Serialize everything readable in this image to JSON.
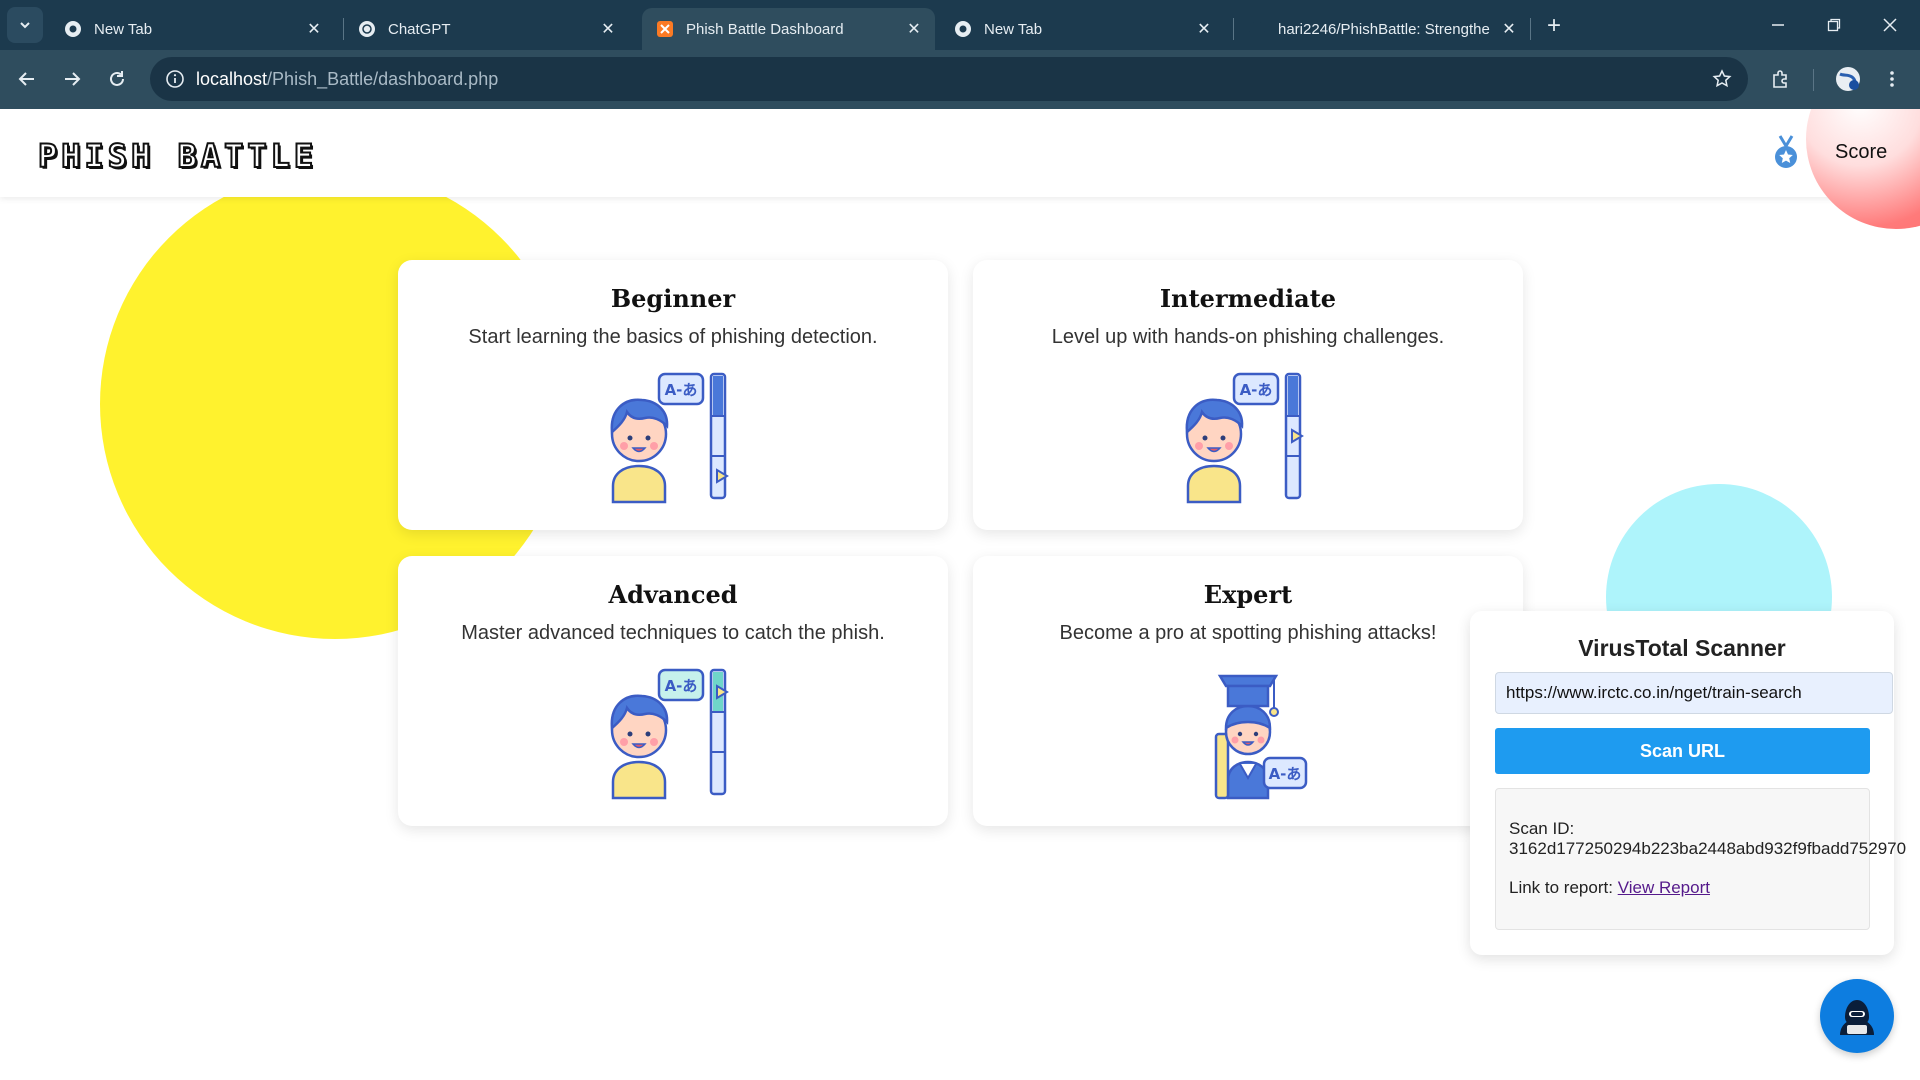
{
  "browser": {
    "tabs": [
      {
        "title": "New Tab",
        "icon": "chrome-icon",
        "active": false
      },
      {
        "title": "ChatGPT",
        "icon": "openai-icon",
        "active": false
      },
      {
        "title": "Phish Battle Dashboard",
        "icon": "xampp-icon",
        "active": true
      },
      {
        "title": "New Tab",
        "icon": "chrome-icon",
        "active": false
      },
      {
        "title": "hari2246/PhishBattle: Strengthe",
        "icon": "github-icon",
        "active": false
      }
    ],
    "url_host": "localhost",
    "url_path": "/Phish_Battle/dashboard.php"
  },
  "header": {
    "logo": "PHISH BATTLE",
    "score_label": "Score"
  },
  "levels": [
    {
      "title": "Beginner",
      "description": "Start learning the basics of phishing detection."
    },
    {
      "title": "Intermediate",
      "description": "Level up with hands-on phishing challenges."
    },
    {
      "title": "Advanced",
      "description": "Master advanced techniques to catch the phish."
    },
    {
      "title": "Expert",
      "description": "Become a pro at spotting phishing attacks!"
    }
  ],
  "scanner": {
    "title": "VirusTotal Scanner",
    "input_value": "https://www.irctc.co.in/nget/train-search",
    "button_label": "Scan URL",
    "scan_id_label": "Scan ID:",
    "scan_id": "3162d177250294b223ba2448abd932f9fbadd752970",
    "report_label": "Link to report:",
    "report_link": "View Report"
  },
  "colors": {
    "accent": "#1e9bf0",
    "yellow_blob": "#fff22e",
    "cyan_blob": "#aef4fb",
    "red_blob": "#ff6b6b",
    "chrome_dark": "#1c3a4e"
  }
}
